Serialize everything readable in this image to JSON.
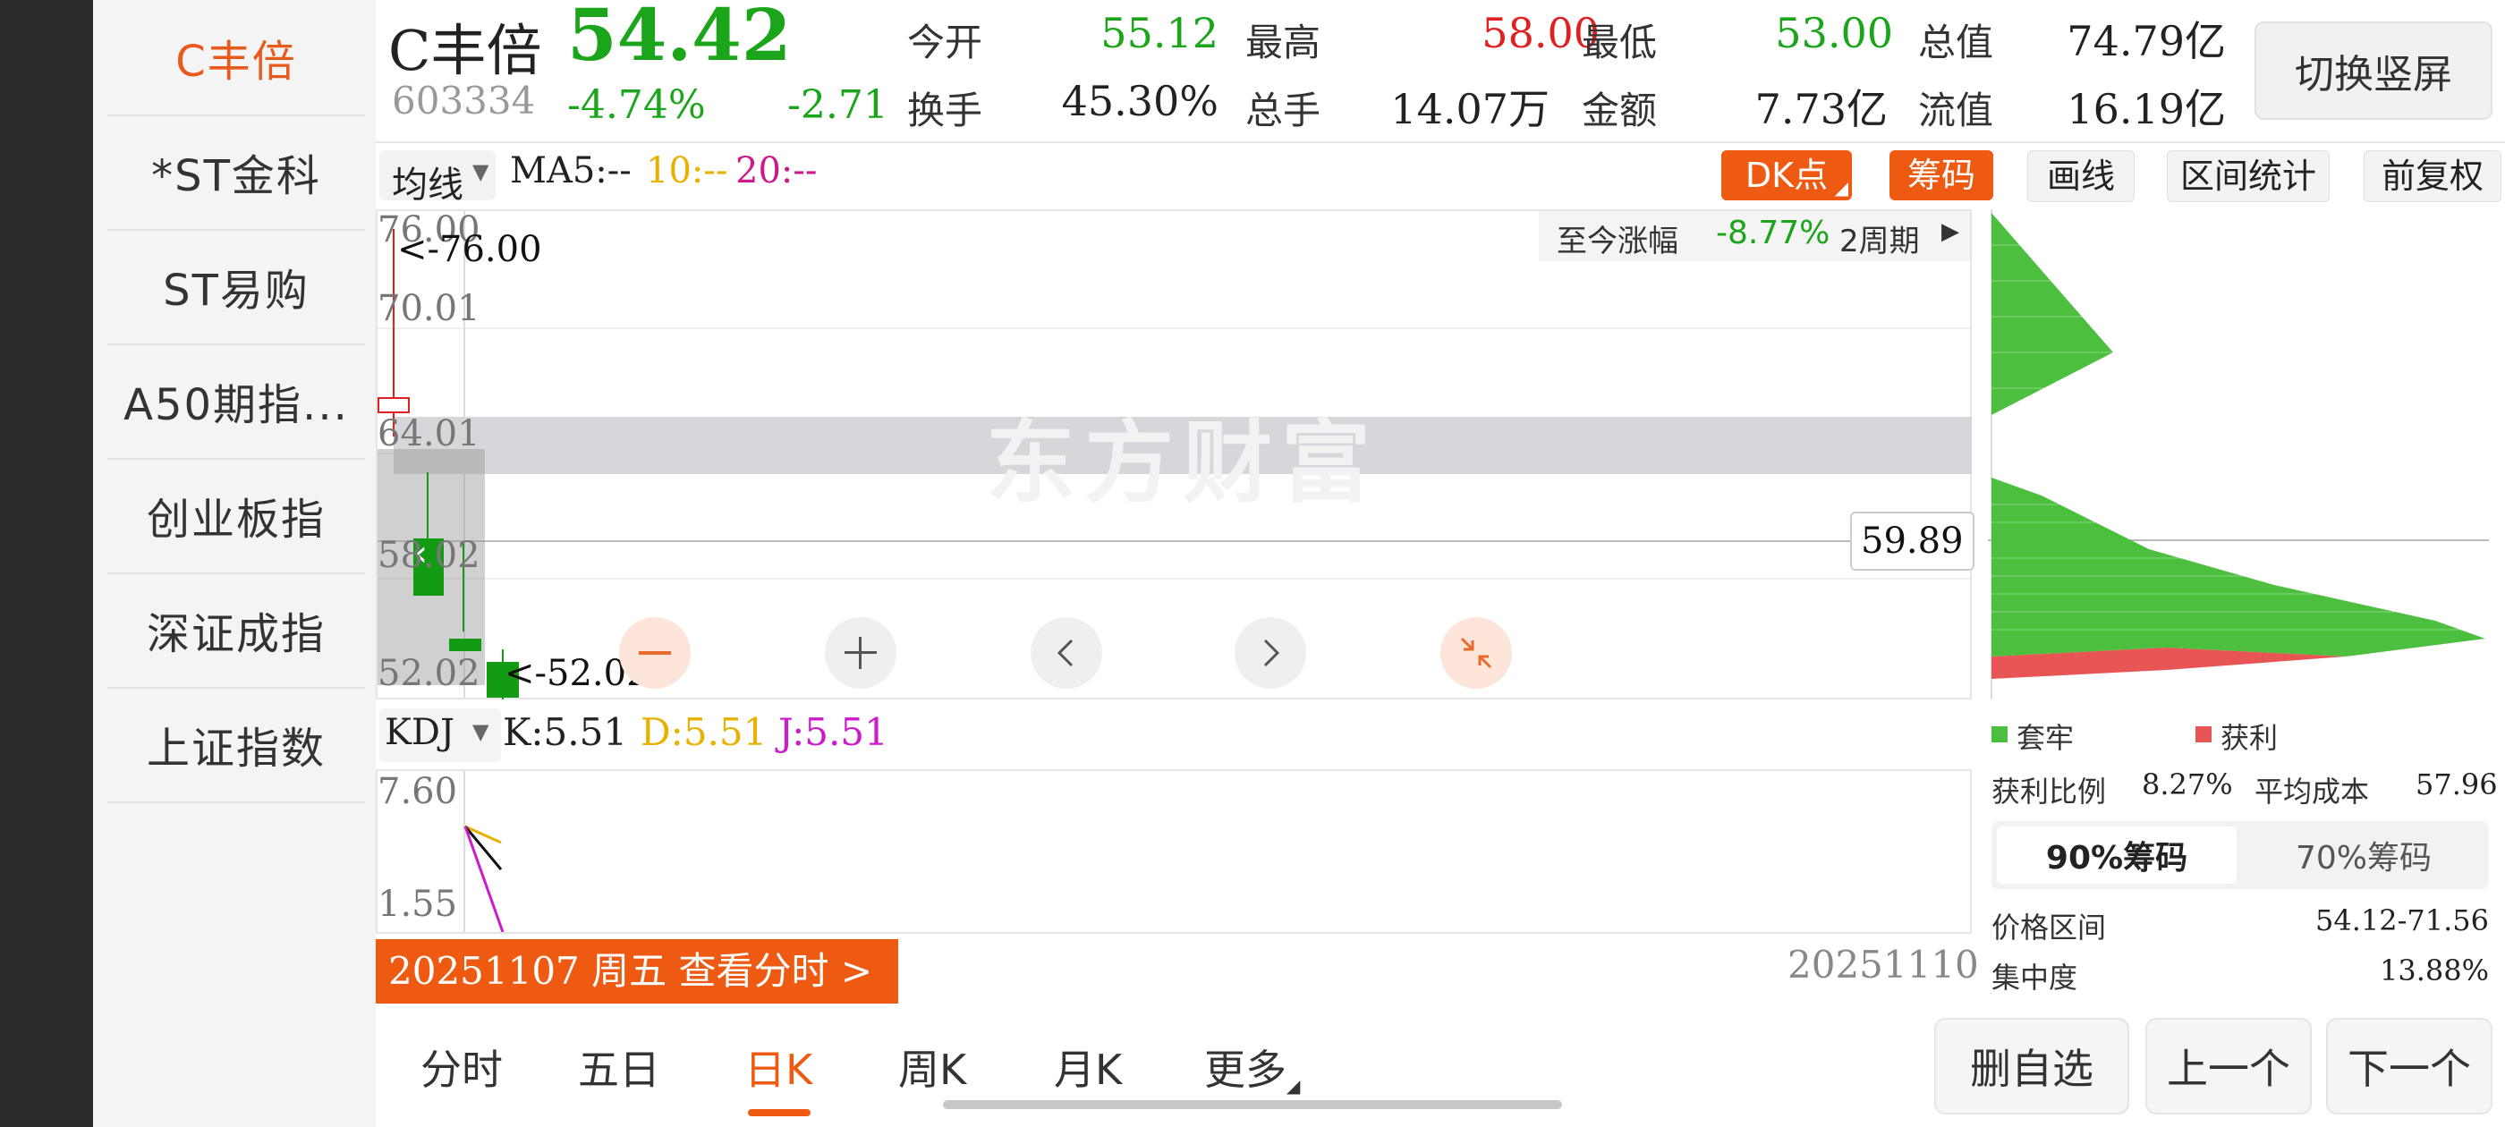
{
  "sidebar": {
    "items": [
      "C丰倍",
      "*ST金科",
      "ST易购",
      "A50期指...",
      "创业板指",
      "深证成指",
      "上证指数"
    ]
  },
  "quote": {
    "name": "C丰倍",
    "code": "603334",
    "price": "54.42",
    "change_pct": "-4.74%",
    "change": "-2.71",
    "open_label": "今开",
    "open": "55.12",
    "high_label": "最高",
    "high": "58.00",
    "low_label": "最低",
    "low": "53.00",
    "total_value_label": "总值",
    "total_value": "74.79亿",
    "turnover_label": "换手",
    "turnover": "45.30%",
    "volume_label": "总手",
    "volume": "14.07万",
    "amount_label": "金额",
    "amount": "7.73亿",
    "float_value_label": "流值",
    "float_value": "16.19亿",
    "switch_button": "切换竖屏"
  },
  "chart_toolbar": {
    "indicator": "均线",
    "ma5": "MA5:--",
    "ma10": "10:--",
    "ma20": "20:--",
    "dk": "DK点",
    "chip": "筹码",
    "draw": "画线",
    "range_stats": "区间统计",
    "adjust": "前复权"
  },
  "kline": {
    "y_ticks": [
      "76.00",
      "70.01",
      "64.01",
      "58.02",
      "52.02"
    ],
    "max_marker": "<-76.00",
    "min_marker": "<-52.02",
    "crosshair_price": "59.89",
    "period_change_label": "至今涨幅",
    "period_change": "-8.77%",
    "period": "2周期",
    "watermark": "东方财富",
    "colors": {
      "up": "#e02020",
      "down": "#139b13",
      "ma10": "#e8b100",
      "ma20": "#cc1a8a"
    }
  },
  "kdj": {
    "name": "KDJ",
    "k": "K:5.51",
    "d": "D:5.51",
    "j": "J:5.51",
    "y_ticks": [
      "7.60",
      "1.55"
    ]
  },
  "date_bar": {
    "selected": "20251107 周五 查看分时 >",
    "end_date": "20251110"
  },
  "chips_panel": {
    "legend_trapped": "套牢",
    "legend_profit": "获利",
    "profit_ratio_label": "获利比例",
    "profit_ratio": "8.27%",
    "avg_cost_label": "平均成本",
    "avg_cost": "57.96",
    "tab_90": "90%筹码",
    "tab_70": "70%筹码",
    "price_range_label": "价格区间",
    "price_range": "54.12-71.56",
    "concentration_label": "集中度",
    "concentration": "13.88%"
  },
  "bottom_tabs": [
    "分时",
    "五日",
    "日K",
    "周K",
    "月K",
    "更多"
  ],
  "bottom_buttons": {
    "delete": "删自选",
    "prev": "上一个",
    "next": "下一个"
  }
}
